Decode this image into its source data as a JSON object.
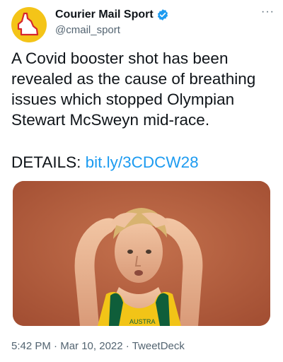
{
  "account": {
    "display_name": "Courier Mail Sport",
    "handle": "@cmail_sport",
    "verified": true
  },
  "more_label": "···",
  "tweet": {
    "text": "A Covid booster shot has been revealed as the cause of breathing issues which stopped Olympian Stewart McSweyn mid-race.",
    "details_label": "DETAILS:",
    "link": "bit.ly/3CDCW28"
  },
  "media": {
    "description_icon": "athlete-photo",
    "singlet_text": "AUSTRA"
  },
  "meta": {
    "time": "5:42 PM",
    "date": "Mar 10, 2022",
    "client": "TweetDeck",
    "separator": "·"
  },
  "colors": {
    "link": "#1d9bf0",
    "verified": "#1d9bf0",
    "avatar_bg": "#f4c418",
    "secondary": "#536471"
  }
}
